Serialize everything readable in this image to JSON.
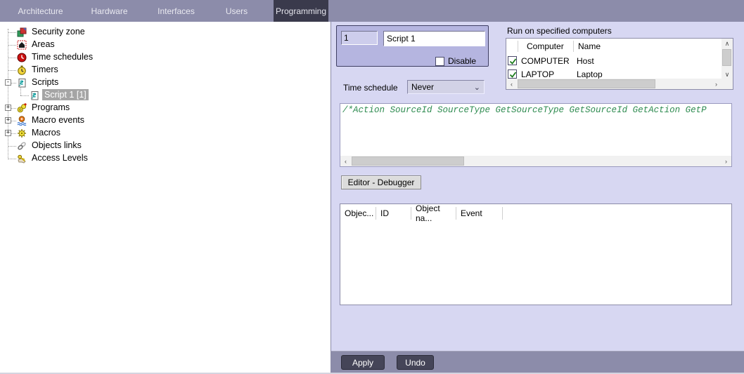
{
  "nav": {
    "tabs": [
      {
        "label": "Architecture",
        "active": false
      },
      {
        "label": "Hardware",
        "active": false
      },
      {
        "label": "Interfaces",
        "active": false
      },
      {
        "label": "Users",
        "active": false
      },
      {
        "label": "Programming",
        "active": true
      }
    ]
  },
  "tree": {
    "items": [
      {
        "label": "Security zone",
        "icon": "security-zone-icon",
        "level": 0,
        "expander": "none",
        "selected": false
      },
      {
        "label": "Areas",
        "icon": "areas-icon",
        "level": 0,
        "expander": "none",
        "selected": false
      },
      {
        "label": "Time schedules",
        "icon": "time-schedules-icon",
        "level": 0,
        "expander": "none",
        "selected": false
      },
      {
        "label": "Timers",
        "icon": "timers-icon",
        "level": 0,
        "expander": "none",
        "selected": false
      },
      {
        "label": "Scripts",
        "icon": "scripts-icon",
        "level": 0,
        "expander": "minus",
        "selected": false
      },
      {
        "label": "Script 1 [1]",
        "icon": "script-icon",
        "level": 1,
        "expander": "none",
        "selected": true
      },
      {
        "label": "Programs",
        "icon": "programs-icon",
        "level": 0,
        "expander": "plus",
        "selected": false
      },
      {
        "label": "Macro events",
        "icon": "macro-events-icon",
        "level": 0,
        "expander": "plus",
        "selected": false
      },
      {
        "label": "Macros",
        "icon": "macros-icon",
        "level": 0,
        "expander": "plus",
        "selected": false
      },
      {
        "label": "Objects links",
        "icon": "objects-links-icon",
        "level": 0,
        "expander": "none",
        "selected": false
      },
      {
        "label": "Access Levels",
        "icon": "access-levels-icon",
        "level": 0,
        "expander": "none",
        "selected": false
      }
    ]
  },
  "editor_panel": {
    "script_id": "1",
    "script_name": "Script 1",
    "disable_label": "Disable",
    "computers": {
      "title": "Run on specified computers",
      "columns": [
        "Computer",
        "Name"
      ],
      "rows": [
        {
          "checked": true,
          "computer": "COMPUTER",
          "name": "Host"
        },
        {
          "checked": true,
          "computer": "LAPTOP",
          "name": "Laptop"
        }
      ]
    },
    "time_schedule": {
      "label": "Time schedule",
      "value": "Never"
    },
    "code": "/*Action SourceId SourceType GetSourceType GetSourceId GetAction GetP",
    "editor_debugger_label": "Editor - Debugger",
    "events_table": {
      "columns": [
        "Objec...",
        "ID",
        "Object na...",
        "Event"
      ]
    },
    "apply_label": "Apply",
    "undo_label": "Undo"
  },
  "colors": {
    "navbar": "#8c8caa",
    "active_tab": "#3a3a4c",
    "panel_bg": "#d7d7f2",
    "group_bg": "#b5b5e0",
    "selection_bg": "#a5a5a5",
    "code_green": "#2e8b50",
    "check_green": "#1c7c1c"
  }
}
